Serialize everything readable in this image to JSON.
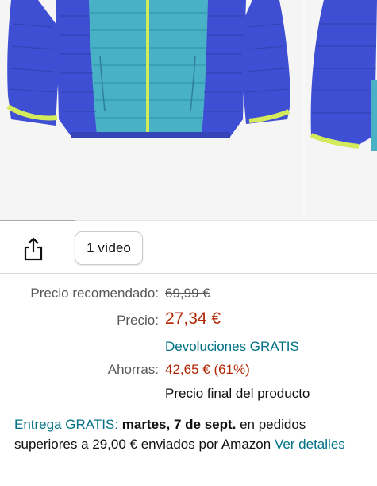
{
  "gallery": {
    "product_image": "jacket-photo",
    "next_image": "jacket-photo-2",
    "colors": {
      "blue": "#3f4fd0",
      "teal": "#4ab3c4",
      "lime": "#d3ea5c"
    }
  },
  "actions": {
    "share_icon": "share-icon",
    "video_label": "1 vídeo"
  },
  "price": {
    "recommended_label": "Precio recomendado:",
    "recommended_value": "69,99 €",
    "price_label": "Precio:",
    "price_value": "27,34 €",
    "returns_link": "Devoluciones GRATIS",
    "savings_label": "Ahorras:",
    "savings_value": "42,65 € (61%)",
    "final_note": "Precio final del producto"
  },
  "delivery": {
    "free_link": "Entrega GRATIS:",
    "date": "martes, 7 de sept.",
    "text": " en pedidos superiores a 29,00 € enviados por Amazon ",
    "details_link": "Ver detalles"
  }
}
